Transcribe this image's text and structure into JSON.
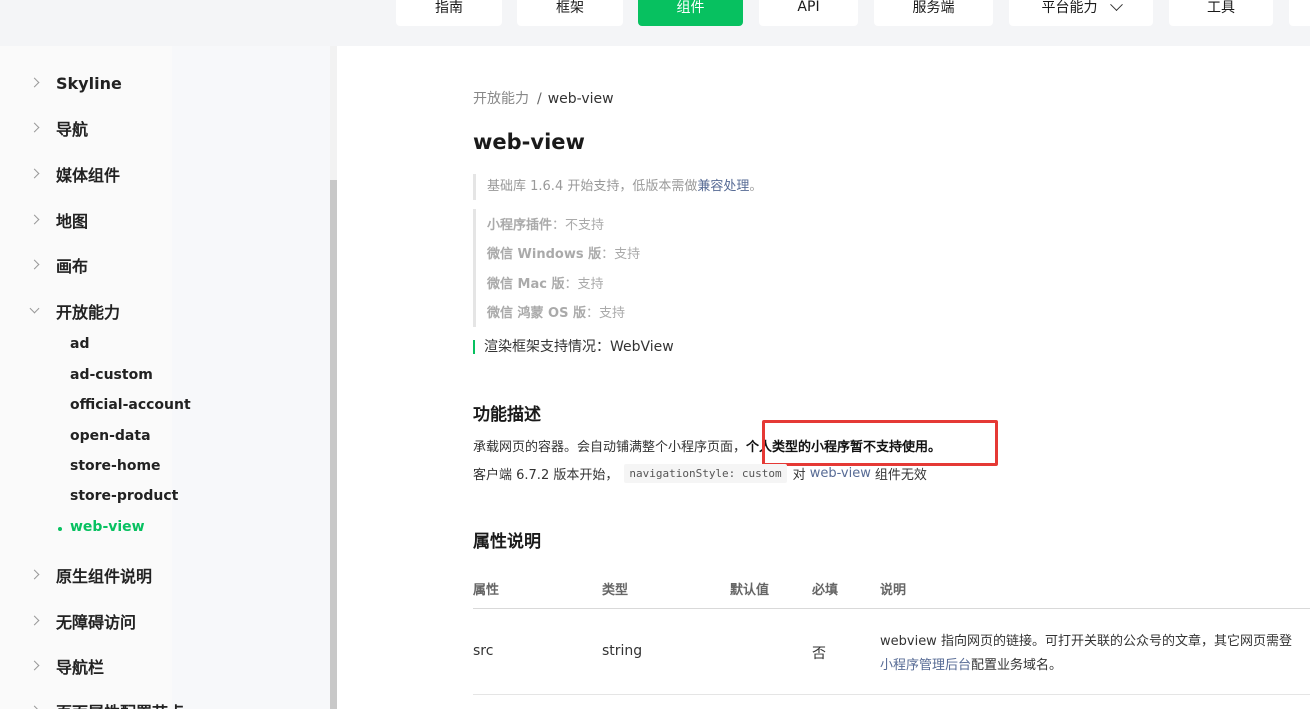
{
  "nav": {
    "items": [
      {
        "label": "指南",
        "active": false
      },
      {
        "label": "框架",
        "active": false
      },
      {
        "label": "组件",
        "active": true
      },
      {
        "label": "API",
        "active": false
      },
      {
        "label": "服务端",
        "active": false
      },
      {
        "label": "平台能力",
        "active": false
      },
      {
        "label": "工具",
        "active": false
      }
    ],
    "accent": "#07c160"
  },
  "sidebar": {
    "items": [
      {
        "label": "Skyline"
      },
      {
        "label": "导航"
      },
      {
        "label": "媒体组件"
      },
      {
        "label": "地图"
      },
      {
        "label": "画布"
      },
      {
        "label": "开放能力"
      },
      {
        "label": "原生组件说明"
      },
      {
        "label": "无障碍访问"
      },
      {
        "label": "导航栏"
      },
      {
        "label": "页面属性配置节点"
      }
    ],
    "subitems": [
      {
        "label": "ad"
      },
      {
        "label": "ad-custom"
      },
      {
        "label": "official-account"
      },
      {
        "label": "open-data"
      },
      {
        "label": "store-home"
      },
      {
        "label": "store-product"
      },
      {
        "label": "web-view"
      }
    ]
  },
  "breadcrumb": {
    "parent": "开放能力",
    "separator": "/",
    "current": "web-view"
  },
  "page": {
    "title": "web-view",
    "base_note_pre": "基础库 1.6.4 开始支持，低版本需做",
    "base_note_link": "兼容处理",
    "base_note_post": "。",
    "support": [
      {
        "key": "小程序插件",
        "value": "：不支持"
      },
      {
        "key": "微信 Windows 版",
        "value": "：支持"
      },
      {
        "key": "微信 Mac 版",
        "value": "：支持"
      },
      {
        "key": "微信 鸿蒙 OS 版",
        "value": "：支持"
      }
    ],
    "render_note": "渲染框架支持情况：WebView",
    "section1": "功能描述",
    "desc1_plain": "承载网页的容器。会自动铺满整个小程序页面，",
    "desc1_bold": "个人类型的小程序暂不支持使用。",
    "desc2_pre": "客户端 6.7.2 版本开始，",
    "desc2_code": "navigationStyle: custom",
    "desc2_mid": "对",
    "desc2_link": "web-view",
    "desc2_post": "组件无效",
    "section2": "属性说明"
  },
  "table": {
    "headers": [
      "属性",
      "类型",
      "默认值",
      "必填",
      "说明"
    ],
    "rows": [
      {
        "attr": "src",
        "type": "string",
        "default": "",
        "required": "否",
        "desc_line1": "webview 指向网页的链接。可打开关联的公众号的文章，其它网页需登",
        "desc_link": "小程序管理后台",
        "desc_line2_post": "配置业务域名。"
      }
    ]
  },
  "colors": {
    "highlight": "#e53935",
    "link": "#576b95"
  }
}
